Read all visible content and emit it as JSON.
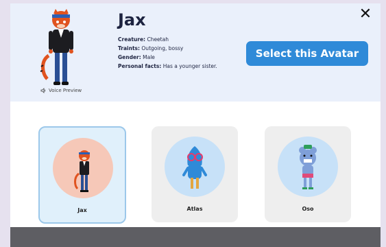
{
  "header": {
    "name": "Jax",
    "creature_label": "Creature:",
    "creature": "Cheetah",
    "traits_label": "Traints:",
    "traits": "Outgoing, bossy",
    "gender_label": "Gender:",
    "gender": "Male",
    "facts_label": "Personal facts:",
    "facts": "Has a younger sister.",
    "voice_preview": "Voice Preview",
    "select_button": "Select this Avatar",
    "close": "✕"
  },
  "avatars": [
    {
      "label": "Jax",
      "selected": true
    },
    {
      "label": "Atlas",
      "selected": false
    },
    {
      "label": "Oso",
      "selected": false
    }
  ],
  "colors": {
    "accent": "#2f8ad8",
    "header_bg": "#eaf0fb",
    "jax_circle": "#f6c8b8",
    "atlas_circle": "#c7e1f8",
    "oso_circle": "#c7e1f8"
  }
}
